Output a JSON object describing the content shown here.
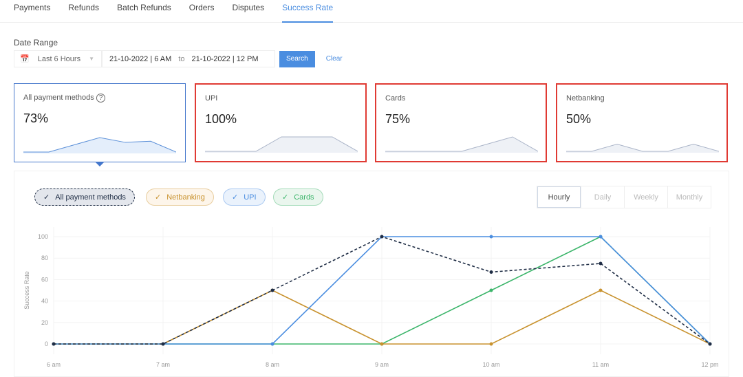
{
  "tabs": [
    "Payments",
    "Refunds",
    "Batch Refunds",
    "Orders",
    "Disputes",
    "Success Rate"
  ],
  "date_range": {
    "label": "Date Range",
    "preset": "Last 6 Hours",
    "from": "21-10-2022 | 6 AM",
    "to_label": "to",
    "to": "21-10-2022 | 12 PM",
    "search": "Search",
    "clear": "Clear"
  },
  "cards": [
    {
      "title": "All payment methods",
      "value": "73%",
      "selected": true,
      "trend": [
        0,
        0,
        50,
        100,
        67,
        75,
        0
      ]
    },
    {
      "title": "UPI",
      "value": "100%",
      "trend": [
        0,
        0,
        0,
        100,
        100,
        100,
        0
      ]
    },
    {
      "title": "Cards",
      "value": "75%",
      "trend": [
        0,
        0,
        0,
        0,
        50,
        100,
        0
      ]
    },
    {
      "title": "Netbanking",
      "value": "50%",
      "trend": [
        0,
        0,
        50,
        0,
        0,
        50,
        0
      ]
    }
  ],
  "filters": [
    {
      "label": "All payment methods",
      "color": "#1f2d45"
    },
    {
      "label": "Netbanking",
      "color": "#c8922e"
    },
    {
      "label": "UPI",
      "color": "#4a8de0"
    },
    {
      "label": "Cards",
      "color": "#3bb56a"
    }
  ],
  "granularity": [
    "Hourly",
    "Daily",
    "Weekly",
    "Monthly"
  ],
  "chart_data": {
    "type": "line",
    "ylabel": "Success Rate",
    "x": [
      "6 am",
      "7 am",
      "8 am",
      "9 am",
      "10 am",
      "11 am",
      "12 pm"
    ],
    "yticks": [
      0,
      20,
      40,
      60,
      80,
      100
    ],
    "ylim": [
      0,
      100
    ],
    "series": [
      {
        "name": "Cards",
        "color": "#3bb56a",
        "values": [
          0,
          0,
          0,
          0,
          50,
          100,
          0
        ]
      },
      {
        "name": "Netbanking",
        "color": "#c8922e",
        "values": [
          0,
          0,
          50,
          0,
          0,
          50,
          0
        ]
      },
      {
        "name": "UPI",
        "color": "#4a8de0",
        "values": [
          0,
          0,
          0,
          100,
          100,
          100,
          0
        ]
      },
      {
        "name": "All payment methods",
        "color": "#1f2d45",
        "dashed": true,
        "values": [
          0,
          0,
          50,
          100,
          67,
          75,
          0
        ]
      }
    ]
  }
}
